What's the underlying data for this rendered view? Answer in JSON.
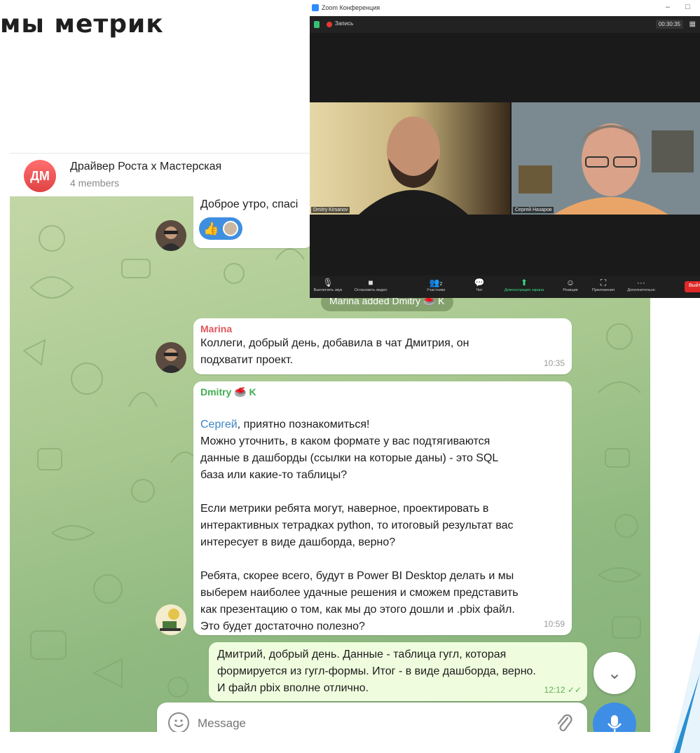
{
  "slide": {
    "title": "мы метрик"
  },
  "telegram": {
    "chat": {
      "avatar_initials": "ДМ",
      "title": "Драйвер Роста x Мастерская",
      "members": "4 members"
    },
    "messages": [
      {
        "id": "m0",
        "text": "Доброе утро, спасі",
        "reaction": "👍"
      },
      {
        "id": "m1",
        "sender": "Marina",
        "sender_color": "#e0565b",
        "text": "Коллеги,  добрый день,  добавила в чат Дмитрия,  он\nподхватит проект.",
        "time": "10:35"
      },
      {
        "id": "m2",
        "sender": "Dmitry 🥌 K",
        "sender_color": "#3fae4f",
        "mention": "Сергей",
        "text_after_mention": ", приятно познакомиться!",
        "paragraphs": [
          "Можно уточнить, в каком формате у вас подтягиваются\nданные в дашборды (ссылки на которые даны) - это SQL\nбаза или какие-то таблицы?",
          "Если метрики ребята могут, наверное, проектировать в\nинтерактивных тетрадках python, то итоговый результат вас\nинтересует в виде дашборда, верно?",
          "Ребята, скорее всего, будут в Power BI Desktop делать и мы\nвыберем наиболее удачные решения и сможем представить\nкак презентацию о том, как мы до этого дошли и .pbix файл.\nЭто будет достаточно полезно?"
        ],
        "time": "10:59"
      },
      {
        "id": "m3",
        "outgoing": true,
        "text": "Дмитрий, добрый день. Данные - таблица гугл, которая\nформируется из гугл-формы. Итог - в виде дашборда, верно.\nИ файл pbix вполне отлично.",
        "time": "12:12",
        "status_icon": "double-check-icon"
      }
    ],
    "service_message": "Marina added Dmitry 🥌 K",
    "composer": {
      "placeholder": "Message"
    },
    "colors": {
      "accent": "#3e8ee6",
      "outgoing_bubble": "#effdde",
      "chat_bg": "#a8c890"
    }
  },
  "zoom": {
    "window_title": "Zoom Конференция",
    "window_controls": [
      "–",
      "□"
    ],
    "recording_label": "Запись",
    "timer": "00:30:35",
    "participants": [
      {
        "name": "Dmitry Kirsanov"
      },
      {
        "name": "Сергей Назаров"
      }
    ],
    "toolbar": [
      {
        "label": "Выключить звук",
        "icon": "mic-icon",
        "glyph": "🎙"
      },
      {
        "label": "Остановить видео",
        "icon": "video-icon",
        "glyph": "■"
      },
      {
        "label": "Участники",
        "icon": "participants-icon",
        "glyph": "👥",
        "count": "2"
      },
      {
        "label": "Чат",
        "icon": "chat-icon",
        "glyph": "💬"
      },
      {
        "label": "Демонстрация экрана",
        "icon": "share-screen-icon",
        "glyph": "⬆"
      },
      {
        "label": "Реакции",
        "icon": "reactions-icon",
        "glyph": "☺"
      },
      {
        "label": "Приложения",
        "icon": "apps-icon",
        "glyph": "⛶"
      },
      {
        "label": "Дополнительно",
        "icon": "more-icon",
        "glyph": "···"
      }
    ],
    "leave_label": "Выйти"
  }
}
